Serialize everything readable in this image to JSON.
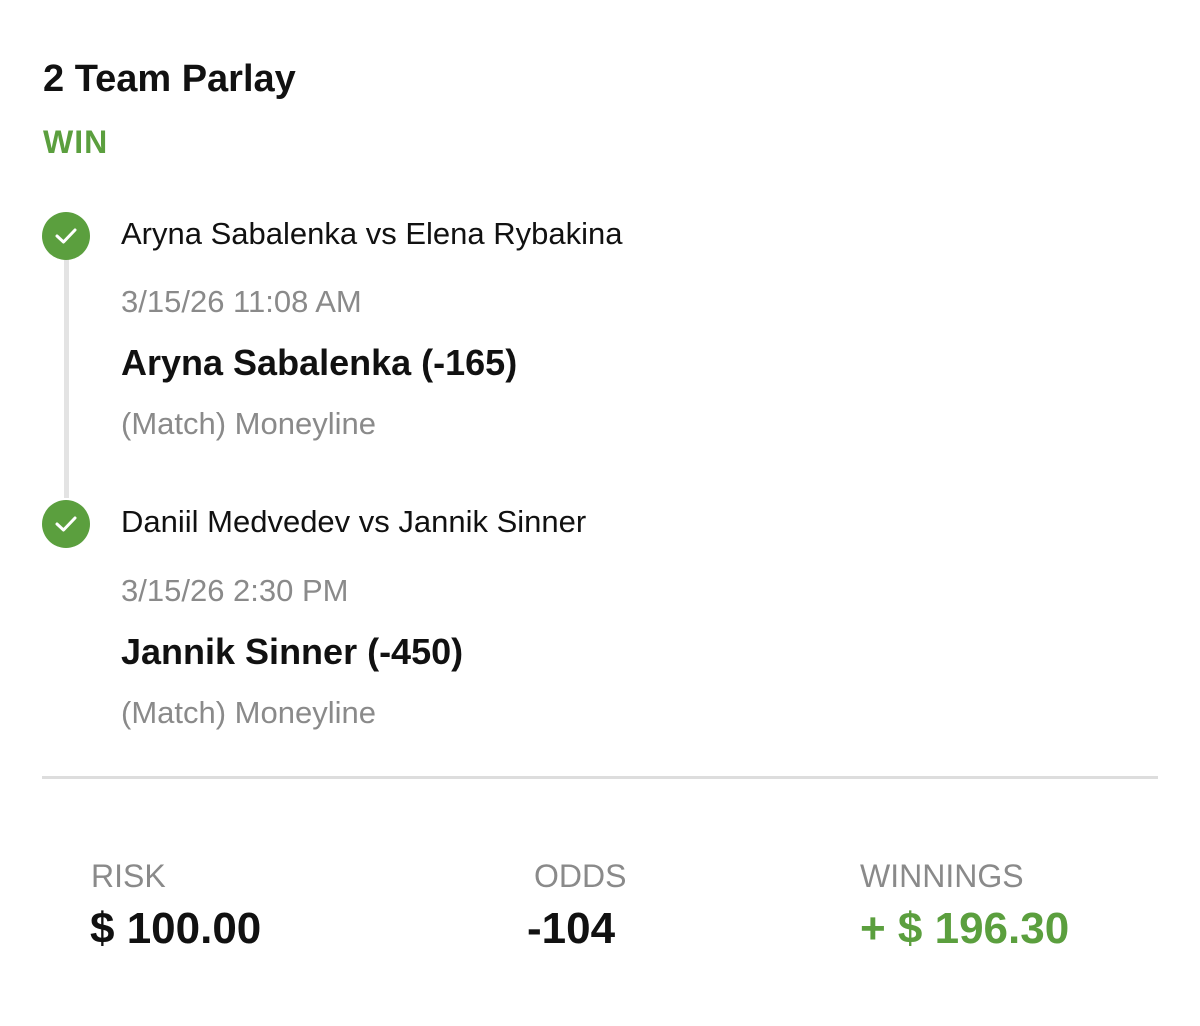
{
  "bet": {
    "title": "2 Team Parlay",
    "status": "WIN",
    "status_color": "#5b9f3e"
  },
  "legs": [
    {
      "event": "Aryna Sabalenka vs Elena Rybakina",
      "datetime": "3/15/26 11:08 AM",
      "pick": "Aryna Sabalenka (-165)",
      "market": "(Match) Moneyline",
      "icon": "check-circle-icon"
    },
    {
      "event": "Daniil Medvedev vs Jannik Sinner",
      "datetime": "3/15/26 2:30 PM",
      "pick": "Jannik Sinner (-450)",
      "market": "(Match) Moneyline",
      "icon": "check-circle-icon"
    }
  ],
  "summary": {
    "risk_label": "RISK",
    "risk_value": "$ 100.00",
    "odds_label": "ODDS",
    "odds_value": "-104",
    "winnings_label": "WINNINGS",
    "winnings_value": "+ $ 196.30"
  }
}
